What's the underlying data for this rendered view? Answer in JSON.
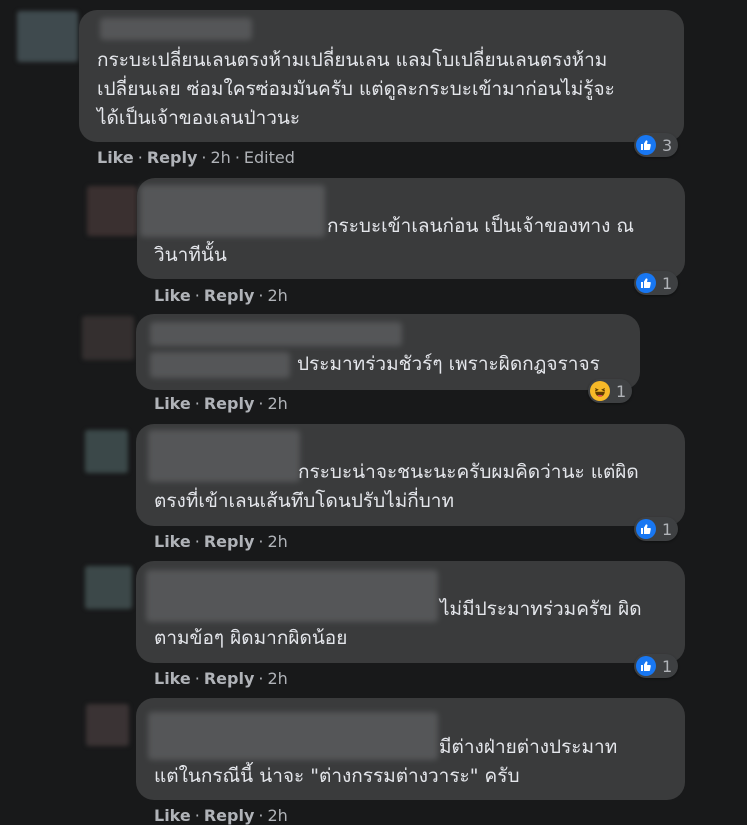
{
  "comments": [
    {
      "lines": [
        "กระบะเปลี่ยนเลนตรงห้ามเปลี่ยนเลน แลมโบเปลี่ยนเลนตรงห้าม",
        "เปลี่ยนเลย ซ่อมใครซ่อมมันครับ แต่ดูละกระบะเข้ามาก่อนไม่รู้จะ",
        "ได้เป็นเจ้าของเลนป่าวนะ"
      ],
      "like": "Like",
      "reply": "Reply",
      "time": "2h",
      "edited": "Edited",
      "reaction": "like",
      "count": "3"
    },
    {
      "lines": [
        "กระบะเข้าเลนก่อน เป็นเจ้าของทาง ณ",
        "วินาทีนั้น"
      ],
      "like": "Like",
      "reply": "Reply",
      "time": "2h",
      "reaction": "like",
      "count": "1"
    },
    {
      "lines": [
        "ประมาทร่วมชัวร์ๆ เพราะผิดกฎจราจร"
      ],
      "like": "Like",
      "reply": "Reply",
      "time": "2h",
      "reaction": "haha",
      "count": "1"
    },
    {
      "lines": [
        "กระบะน่าจะชนะนะครับผมคิดว่านะ แต่ผิด",
        "ตรงที่เข้าเลนเส้นทึบโดนปรับไม่กี่บาท"
      ],
      "like": "Like",
      "reply": "Reply",
      "time": "2h",
      "reaction": "like",
      "count": "1"
    },
    {
      "lines": [
        "ไม่มีประมาทร่วมครัข ผิด",
        "ตามข้อๆ ผิดมากผิดน้อย"
      ],
      "like": "Like",
      "reply": "Reply",
      "time": "2h",
      "reaction": "like",
      "count": "1"
    },
    {
      "lines": [
        "มีต่างฝ่ายต่างประมาท",
        "แต่ในกรณีนี้ น่าจะ \"ต่างกรรมต่างวาระ\" ครับ"
      ],
      "like": "Like",
      "reply": "Reply",
      "time": "2h"
    }
  ]
}
